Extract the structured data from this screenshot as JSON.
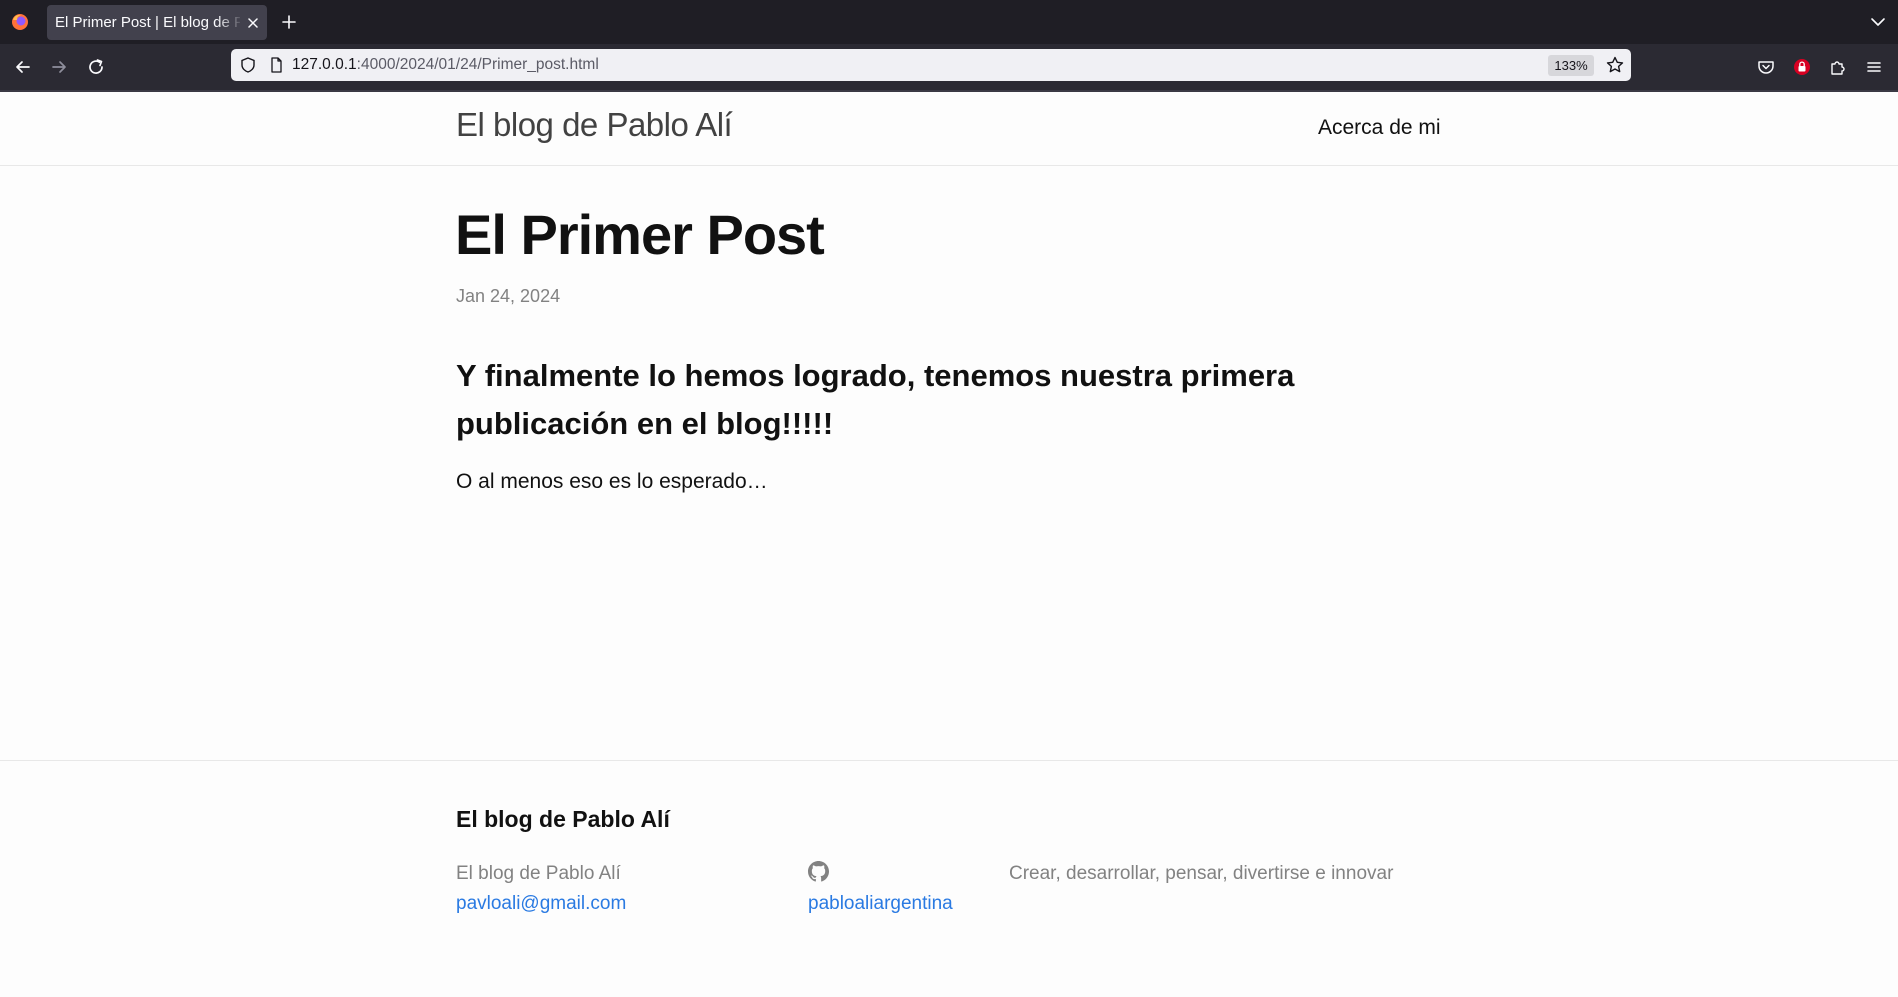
{
  "browser": {
    "tab_title": "El Primer Post | El blog de Pablo Alí",
    "url_host": "127.0.0.1",
    "url_path": ":4000/2024/01/24/Primer_post.html",
    "zoom": "133%"
  },
  "header": {
    "site_title": "El blog de Pablo Alí",
    "nav_about": "Acerca de mi"
  },
  "post": {
    "title": "El Primer Post",
    "date": "Jan 24, 2024",
    "lead": "Y finalmente lo hemos logrado, tenemos nuestra primera publicación en el blog!!!!!",
    "body": "O al menos eso es lo esperado…"
  },
  "footer": {
    "heading": "El blog de Pablo Alí",
    "name": "El blog de Pablo Alí",
    "email": "pavloali@gmail.com",
    "github_user": "pabloaliargentina",
    "tagline": "Crear, desarrollar, pensar, divertirse e innovar"
  },
  "colors": {
    "link": "#2a7ae2",
    "muted": "#828282",
    "chrome_dark": "#1f1e25"
  }
}
